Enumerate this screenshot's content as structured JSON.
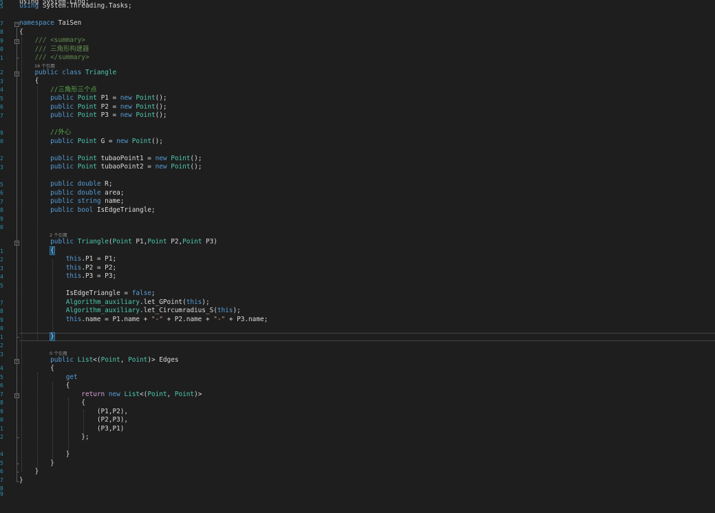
{
  "editor": {
    "colors": {
      "background": "#1e1e1e",
      "keyword": "#569cd6",
      "control_keyword": "#d8a0df",
      "type": "#4ec9b0",
      "comment": "#57a64a",
      "string": "#d69d85",
      "line_number": "#2b91af"
    },
    "gutter_digits": [
      "5",
      "5",
      "",
      "7",
      "8",
      "9",
      "0",
      "1",
      "2",
      "3",
      "4",
      "5",
      "6",
      "7",
      "",
      "9",
      "0",
      "",
      "2",
      "3",
      "",
      "5",
      "6",
      "7",
      "8",
      "9",
      "0",
      "",
      "1",
      "2",
      "3",
      "4",
      "5",
      "",
      "7",
      "8",
      "9",
      "0",
      "1",
      "2",
      "3",
      "",
      "4",
      "5",
      "6",
      "7",
      "8",
      "9",
      "0",
      "1",
      "2",
      "",
      "4",
      "5",
      "6",
      "7",
      "8",
      "9"
    ],
    "code_lens": {
      "triangle_refs": "16 个引用",
      "ctor_refs": "2 个引用",
      "edges_refs": "0 个引用"
    },
    "lines": [
      [
        [
          "pl",
          "using System.Linq;"
        ]
      ],
      [
        [
          "kw",
          "using"
        ],
        [
          "pl",
          " System.Threading.Tasks;"
        ]
      ],
      [],
      [
        [
          "kw",
          "namespace"
        ],
        [
          "pl",
          " TaiSen"
        ]
      ],
      [
        [
          "pl",
          "{"
        ]
      ],
      [
        [
          "doc",
          "    /// <summary>"
        ]
      ],
      [
        [
          "doc",
          "    /// 三角形构建器"
        ]
      ],
      [
        [
          "doc",
          "    /// </summary>"
        ]
      ],
      [
        [
          "kw",
          "    public class"
        ],
        [
          "pl",
          " "
        ],
        [
          "ty",
          "Triangle"
        ]
      ],
      [
        [
          "pl",
          "    {"
        ]
      ],
      [
        [
          "cm",
          "        //三角形三个点"
        ]
      ],
      [
        [
          "kw",
          "        public"
        ],
        [
          "pl",
          " "
        ],
        [
          "ty",
          "Point"
        ],
        [
          "pl",
          " P1 = "
        ],
        [
          "kw",
          "new"
        ],
        [
          "pl",
          " "
        ],
        [
          "ty",
          "Point"
        ],
        [
          "pl",
          "();"
        ]
      ],
      [
        [
          "kw",
          "        public"
        ],
        [
          "pl",
          " "
        ],
        [
          "ty",
          "Point"
        ],
        [
          "pl",
          " P2 = "
        ],
        [
          "kw",
          "new"
        ],
        [
          "pl",
          " "
        ],
        [
          "ty",
          "Point"
        ],
        [
          "pl",
          "();"
        ]
      ],
      [
        [
          "kw",
          "        public"
        ],
        [
          "pl",
          " "
        ],
        [
          "ty",
          "Point"
        ],
        [
          "pl",
          " P3 = "
        ],
        [
          "kw",
          "new"
        ],
        [
          "pl",
          " "
        ],
        [
          "ty",
          "Point"
        ],
        [
          "pl",
          "();"
        ]
      ],
      [],
      [
        [
          "cm",
          "        //外心"
        ]
      ],
      [
        [
          "kw",
          "        public"
        ],
        [
          "pl",
          " "
        ],
        [
          "ty",
          "Point"
        ],
        [
          "pl",
          " G = "
        ],
        [
          "kw",
          "new"
        ],
        [
          "pl",
          " "
        ],
        [
          "ty",
          "Point"
        ],
        [
          "pl",
          "();"
        ]
      ],
      [],
      [
        [
          "kw",
          "        public"
        ],
        [
          "pl",
          " "
        ],
        [
          "ty",
          "Point"
        ],
        [
          "pl",
          " tubaoPoint1 = "
        ],
        [
          "kw",
          "new"
        ],
        [
          "pl",
          " "
        ],
        [
          "ty",
          "Point"
        ],
        [
          "pl",
          "();"
        ]
      ],
      [
        [
          "kw",
          "        public"
        ],
        [
          "pl",
          " "
        ],
        [
          "ty",
          "Point"
        ],
        [
          "pl",
          " tubaoPoint2 = "
        ],
        [
          "kw",
          "new"
        ],
        [
          "pl",
          " "
        ],
        [
          "ty",
          "Point"
        ],
        [
          "pl",
          "();"
        ]
      ],
      [],
      [
        [
          "kw",
          "        public double"
        ],
        [
          "pl",
          " R;"
        ]
      ],
      [
        [
          "kw",
          "        public double"
        ],
        [
          "pl",
          " area;"
        ]
      ],
      [
        [
          "kw",
          "        public string"
        ],
        [
          "pl",
          " name;"
        ]
      ],
      [
        [
          "kw",
          "        public bool"
        ],
        [
          "pl",
          " IsEdgeTriangle;"
        ]
      ],
      [],
      [],
      [
        [
          "kw",
          "        public"
        ],
        [
          "pl",
          " "
        ],
        [
          "ty",
          "Triangle"
        ],
        [
          "pl",
          "("
        ],
        [
          "ty",
          "Point"
        ],
        [
          "pl",
          " P1,"
        ],
        [
          "ty",
          "Point"
        ],
        [
          "pl",
          " P2,"
        ],
        [
          "ty",
          "Point"
        ],
        [
          "pl",
          " P3)"
        ]
      ],
      [
        [
          "pl",
          "        {"
        ]
      ],
      [
        [
          "kw",
          "            this"
        ],
        [
          "pl",
          ".P1 = P1;"
        ]
      ],
      [
        [
          "kw",
          "            this"
        ],
        [
          "pl",
          ".P2 = P2;"
        ]
      ],
      [
        [
          "kw",
          "            this"
        ],
        [
          "pl",
          ".P3 = P3;"
        ]
      ],
      [],
      [
        [
          "pl",
          "            IsEdgeTriangle = "
        ],
        [
          "kw",
          "false"
        ],
        [
          "pl",
          ";"
        ]
      ],
      [
        [
          "ty",
          "            Algorithm_auxiliary"
        ],
        [
          "pl",
          ".let_GPoint("
        ],
        [
          "kw",
          "this"
        ],
        [
          "pl",
          ");"
        ]
      ],
      [
        [
          "ty",
          "            Algorithm_auxiliary"
        ],
        [
          "pl",
          ".let_Circumradius_S("
        ],
        [
          "kw",
          "this"
        ],
        [
          "pl",
          ");"
        ]
      ],
      [
        [
          "kw",
          "            this"
        ],
        [
          "pl",
          ".name = P1.name + "
        ],
        [
          "str",
          "\"-\""
        ],
        [
          "pl",
          " + P2.name + "
        ],
        [
          "str",
          "\"-\""
        ],
        [
          "pl",
          " + P3.name;"
        ]
      ],
      [],
      [
        [
          "pl",
          "        }"
        ]
      ],
      [],
      [],
      [
        [
          "kw",
          "        public"
        ],
        [
          "pl",
          " "
        ],
        [
          "ty",
          "List"
        ],
        [
          "pl",
          "<("
        ],
        [
          "ty",
          "Point"
        ],
        [
          "pl",
          ", "
        ],
        [
          "ty",
          "Point"
        ],
        [
          "pl",
          ")> Edges"
        ]
      ],
      [
        [
          "pl",
          "        {"
        ]
      ],
      [
        [
          "kw",
          "            get"
        ]
      ],
      [
        [
          "pl",
          "            {"
        ]
      ],
      [
        [
          "ctl",
          "                return"
        ],
        [
          "pl",
          " "
        ],
        [
          "kw",
          "new"
        ],
        [
          "pl",
          " "
        ],
        [
          "ty",
          "List"
        ],
        [
          "pl",
          "<("
        ],
        [
          "ty",
          "Point"
        ],
        [
          "pl",
          ", "
        ],
        [
          "ty",
          "Point"
        ],
        [
          "pl",
          ")>"
        ]
      ],
      [
        [
          "pl",
          "                {"
        ]
      ],
      [
        [
          "pl",
          "                    (P1,P2),"
        ]
      ],
      [
        [
          "pl",
          "                    (P2,P3),"
        ]
      ],
      [
        [
          "pl",
          "                    (P3,P1)"
        ]
      ],
      [
        [
          "pl",
          "                };"
        ]
      ],
      [],
      [
        [
          "pl",
          "            }"
        ]
      ],
      [
        [
          "pl",
          "        }"
        ]
      ],
      [
        [
          "pl",
          "    }"
        ]
      ],
      [
        [
          "pl",
          "}"
        ]
      ],
      []
    ]
  }
}
